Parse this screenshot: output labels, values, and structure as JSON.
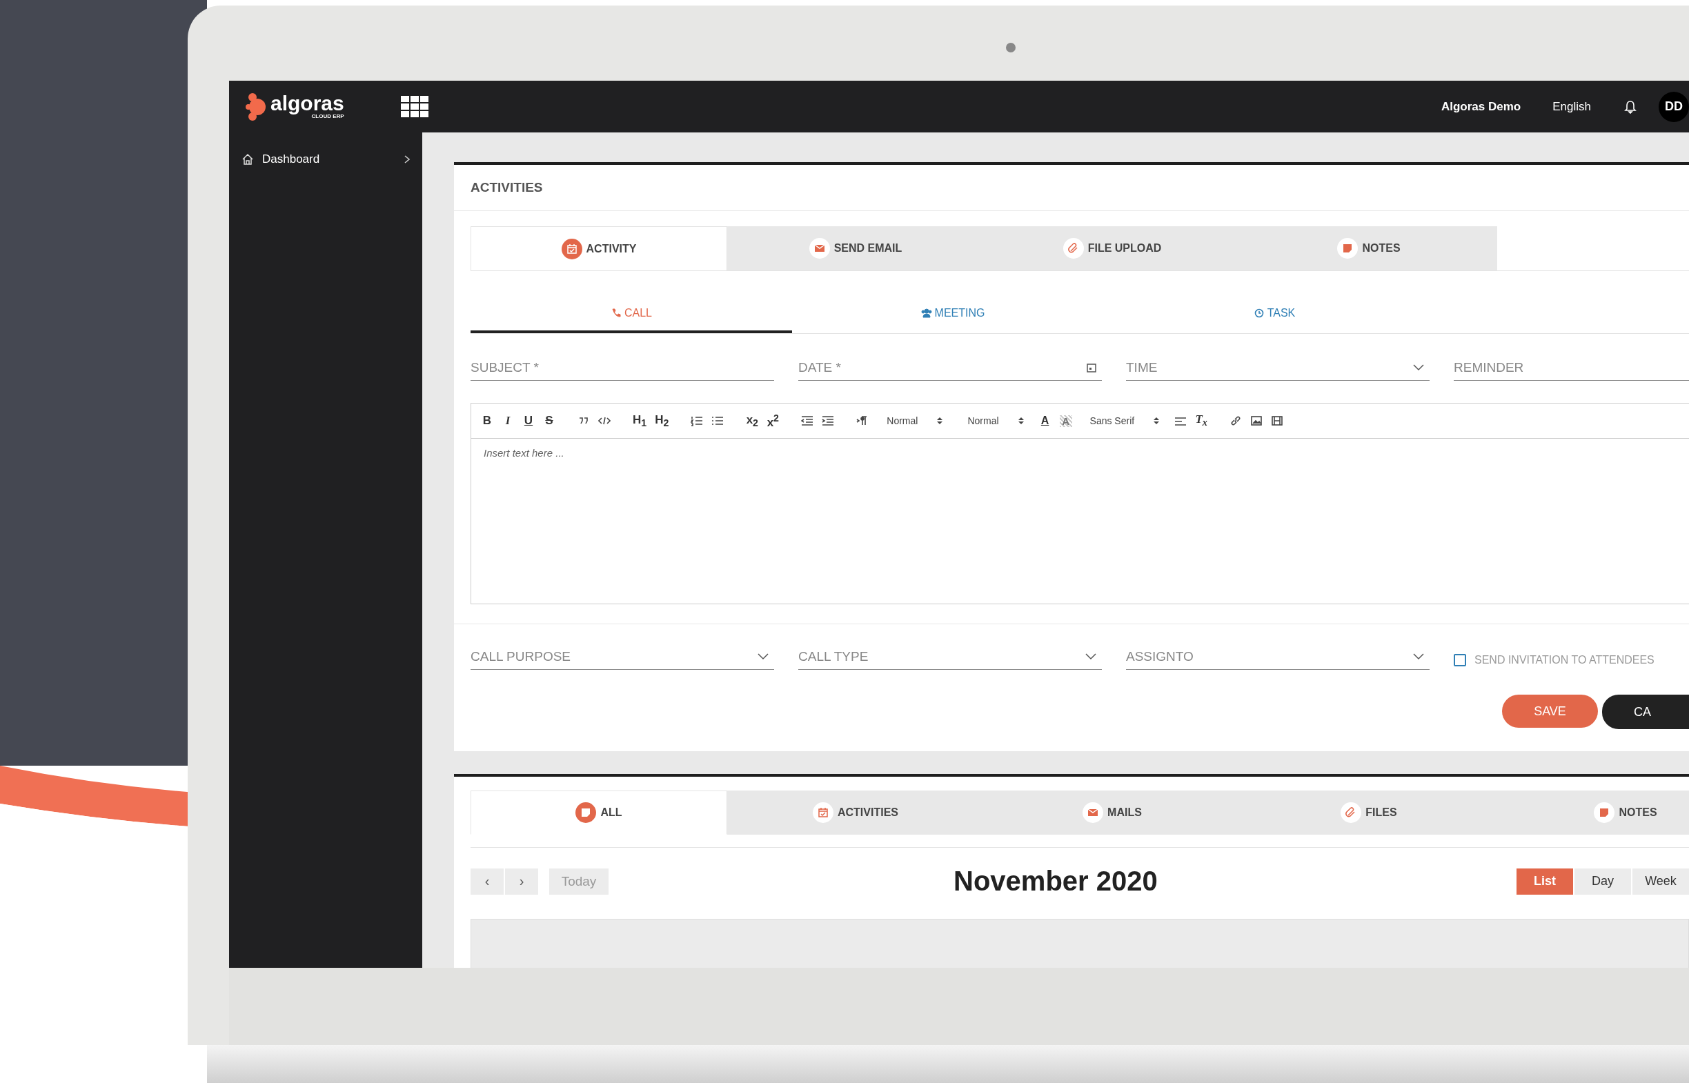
{
  "topbar": {
    "brand": "algoras",
    "brand_sub": "CLOUD ERP",
    "user": "Algoras Demo",
    "language": "English",
    "avatar": "DD"
  },
  "sidebar": {
    "items": [
      {
        "label": "Dashboard",
        "expanded": false
      }
    ]
  },
  "activities": {
    "title": "ACTIVITIES",
    "tabs": [
      {
        "label": "ACTIVITY",
        "kind": "calendar",
        "selected": true
      },
      {
        "label": "SEND EMAIL",
        "kind": "mail",
        "selected": false
      },
      {
        "label": "FILE UPLOAD",
        "kind": "clip",
        "selected": false
      },
      {
        "label": "NOTES",
        "kind": "note",
        "selected": false
      }
    ],
    "subtabs": [
      {
        "label": "CALL",
        "kind": "phone",
        "selected": true
      },
      {
        "label": "MEETING",
        "kind": "users",
        "selected": false
      },
      {
        "label": "TASK",
        "kind": "clock",
        "selected": false
      }
    ],
    "fields": [
      {
        "label": "SUBJECT *",
        "kind": "text"
      },
      {
        "label": "DATE *",
        "kind": "date"
      },
      {
        "label": "TIME",
        "kind": "select"
      },
      {
        "label": "REMINDER",
        "kind": "text"
      }
    ],
    "toolbar": [
      {
        "kind": "bold",
        "text": "B"
      },
      {
        "kind": "italic",
        "text": "I"
      },
      {
        "kind": "underline",
        "text": "U"
      },
      {
        "kind": "strike",
        "text": "S"
      },
      {
        "kind": "gap"
      },
      {
        "kind": "quote"
      },
      {
        "kind": "code"
      },
      {
        "kind": "gap"
      },
      {
        "kind": "heading",
        "text": "H$_{1}$"
      },
      {
        "kind": "heading",
        "text": "H$_{2}$"
      },
      {
        "kind": "gap"
      },
      {
        "kind": "ol"
      },
      {
        "kind": "ul"
      },
      {
        "kind": "gap"
      },
      {
        "kind": "script",
        "text": "x$_{2}$"
      },
      {
        "kind": "script",
        "text": "x$^{2}$"
      },
      {
        "kind": "gap"
      },
      {
        "kind": "outdent"
      },
      {
        "kind": "indent"
      },
      {
        "kind": "gap"
      },
      {
        "kind": "rtl"
      },
      {
        "kind": "select",
        "text": "Normal"
      },
      {
        "kind": "select",
        "text": "Normal"
      },
      {
        "kind": "color",
        "text": "A"
      },
      {
        "kind": "background",
        "text": "A"
      },
      {
        "kind": "select",
        "text": "Sans Serif"
      },
      {
        "kind": "align"
      },
      {
        "kind": "clean",
        "text": "T$_{x}$"
      },
      {
        "kind": "gap"
      },
      {
        "kind": "link"
      },
      {
        "kind": "image"
      },
      {
        "kind": "video"
      }
    ],
    "editor_placeholder": "Insert text here ...",
    "fields2": [
      {
        "label": "CALL PURPOSE",
        "kind": "select"
      },
      {
        "label": "CALL TYPE",
        "kind": "select"
      },
      {
        "label": "ASSIGNTO",
        "kind": "select"
      }
    ],
    "invite": {
      "label": "SEND INVITATION TO ATTENDEES",
      "checked": false
    },
    "buttons": [
      {
        "label": "SAVE",
        "kind": "primary"
      },
      {
        "label": "CA",
        "kind": "dark"
      }
    ]
  },
  "timeline": {
    "tabs": [
      {
        "label": "ALL",
        "kind": "note",
        "selected": true
      },
      {
        "label": "ACTIVITIES",
        "kind": "calendar",
        "selected": false
      },
      {
        "label": "MAILS",
        "kind": "mail",
        "selected": false
      },
      {
        "label": "FILES",
        "kind": "clip",
        "selected": false
      },
      {
        "label": "NOTES",
        "kind": "note",
        "selected": false
      }
    ],
    "calendar": {
      "prev": "‹",
      "next": "›",
      "today": "Today",
      "title": "November 2020",
      "views": [
        {
          "label": "List",
          "selected": true
        },
        {
          "label": "Day",
          "selected": false
        },
        {
          "label": "Week",
          "selected": false
        }
      ]
    }
  }
}
